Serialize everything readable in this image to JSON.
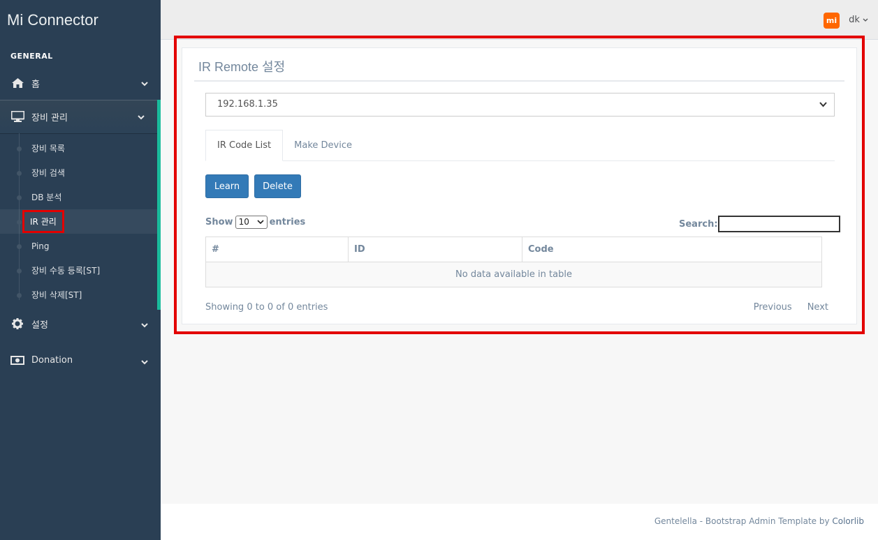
{
  "app": {
    "title": "Mi Connector"
  },
  "sidebar": {
    "section": "GENERAL",
    "items": [
      {
        "label": "홈",
        "icon": "home-icon"
      },
      {
        "label": "장비 관리",
        "icon": "monitor-icon",
        "children": [
          "장비 목록",
          "장비 검색",
          "DB 분석",
          "IR 관리",
          "Ping",
          "장비 수동 등록[ST]",
          "장비 삭제[ST]"
        ]
      },
      {
        "label": "설정",
        "icon": "gear-icon"
      },
      {
        "label": "Donation",
        "icon": "money-icon"
      }
    ]
  },
  "topnav": {
    "logo": "mi",
    "user": "dk"
  },
  "panel": {
    "title": "IR Remote 설정",
    "device_select": "192.168.1.35",
    "tabs": [
      "IR Code List",
      "Make Device"
    ],
    "buttons": {
      "learn": "Learn",
      "delete": "Delete"
    },
    "table_controls": {
      "show": "Show",
      "entries_value": "10",
      "entries": "entries",
      "search": "Search:"
    },
    "columns": [
      "#",
      "ID",
      "Code"
    ],
    "empty": "No data available in table",
    "info": "Showing 0 to 0 of 0 entries",
    "pager": {
      "previous": "Previous",
      "next": "Next"
    }
  },
  "footer": {
    "text": "Gentelella - Bootstrap Admin Template by ",
    "link": "Colorlib"
  },
  "colors": {
    "sidebar": "#2A3F54",
    "accent": "#1ABB9C",
    "primary": "#337AB7",
    "highlight": "#E30000",
    "mi": "#FF6700"
  }
}
